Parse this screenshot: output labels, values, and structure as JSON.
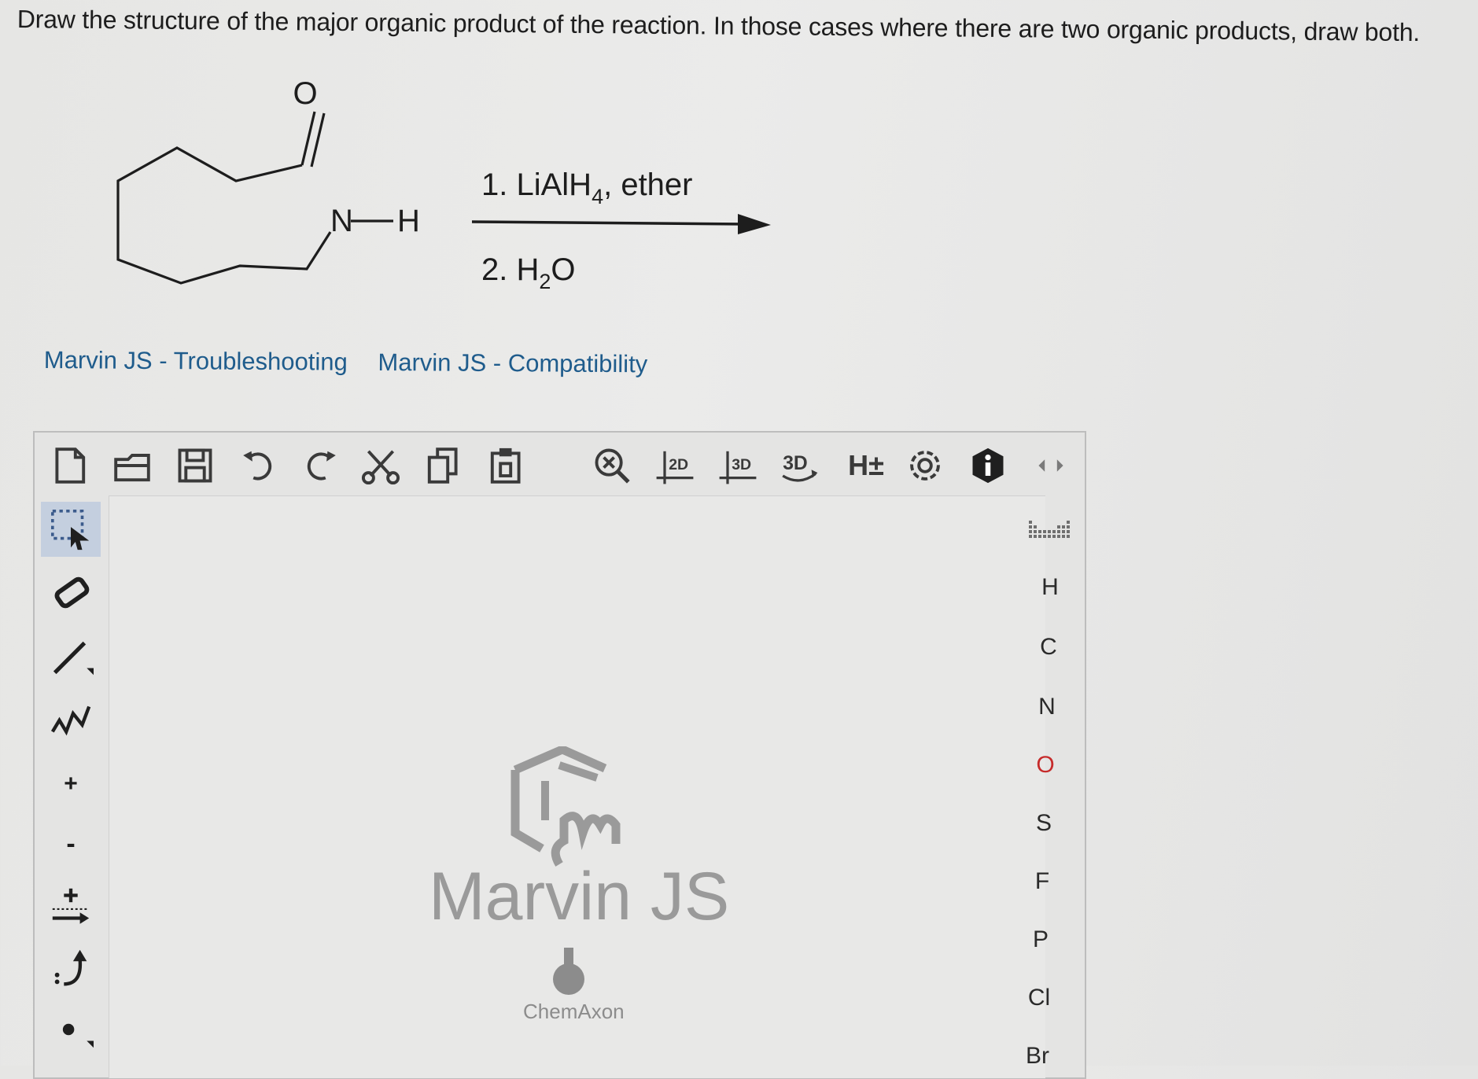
{
  "question": "Draw the structure of the major organic product of the reaction. In those cases where there are two organic products, draw both.",
  "scheme": {
    "carbonyl_o": "O",
    "nh_n": "N",
    "nh_h": "H",
    "step1_prefix": "1. LiAlH",
    "step1_sub": "4",
    "step1_suffix": ", ether",
    "step2_prefix": "2. H",
    "step2_sub": "2",
    "step2_suffix": "O"
  },
  "links": {
    "troubleshooting": "Marvin JS - Troubleshooting",
    "compatibility": "Marvin JS - Compatibility"
  },
  "toolbar": {
    "clean2d": "2D",
    "clean3d": "3D",
    "view3d": "3D",
    "hydrogens": "H±"
  },
  "elements": [
    "H",
    "C",
    "N",
    "O",
    "S",
    "F",
    "P",
    "Cl",
    "Br"
  ],
  "left_tools": {
    "charge_plus": "+",
    "charge_minus": "-"
  },
  "watermark": {
    "product": "Marvin JS",
    "company": "ChemAxon"
  },
  "colors": {
    "link": "#1f5c8c",
    "oxygen": "#c62b2b",
    "active_tool": "#c4cfdf"
  }
}
